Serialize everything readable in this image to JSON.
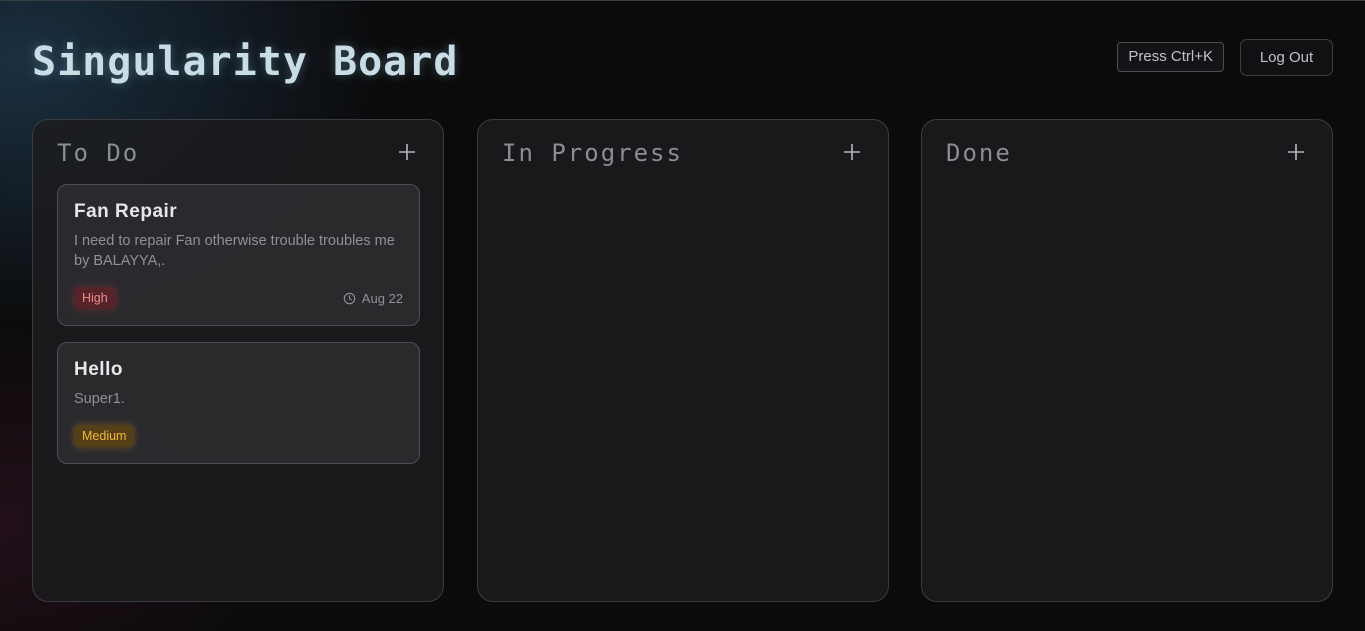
{
  "header": {
    "title": "Singularity Board",
    "shortcut_hint": "Press Ctrl+K",
    "logout_label": "Log Out"
  },
  "columns": [
    {
      "title": "To Do",
      "add_icon": "plus-icon",
      "cards": [
        {
          "title": "Fan Repair",
          "description": "I need to repair Fan otherwise trouble troubles me by BALAYYA,.",
          "priority": "High",
          "due": "Aug 22",
          "due_icon": "clock-icon"
        },
        {
          "title": "Hello",
          "description": "Super1.",
          "priority": "Medium"
        }
      ]
    },
    {
      "title": "In Progress",
      "add_icon": "plus-icon",
      "cards": []
    },
    {
      "title": "Done",
      "add_icon": "plus-icon",
      "cards": []
    }
  ],
  "colors": {
    "priority_high": "#f08a8a",
    "priority_medium": "#f2b838",
    "title_glow": "#c8dde6"
  }
}
